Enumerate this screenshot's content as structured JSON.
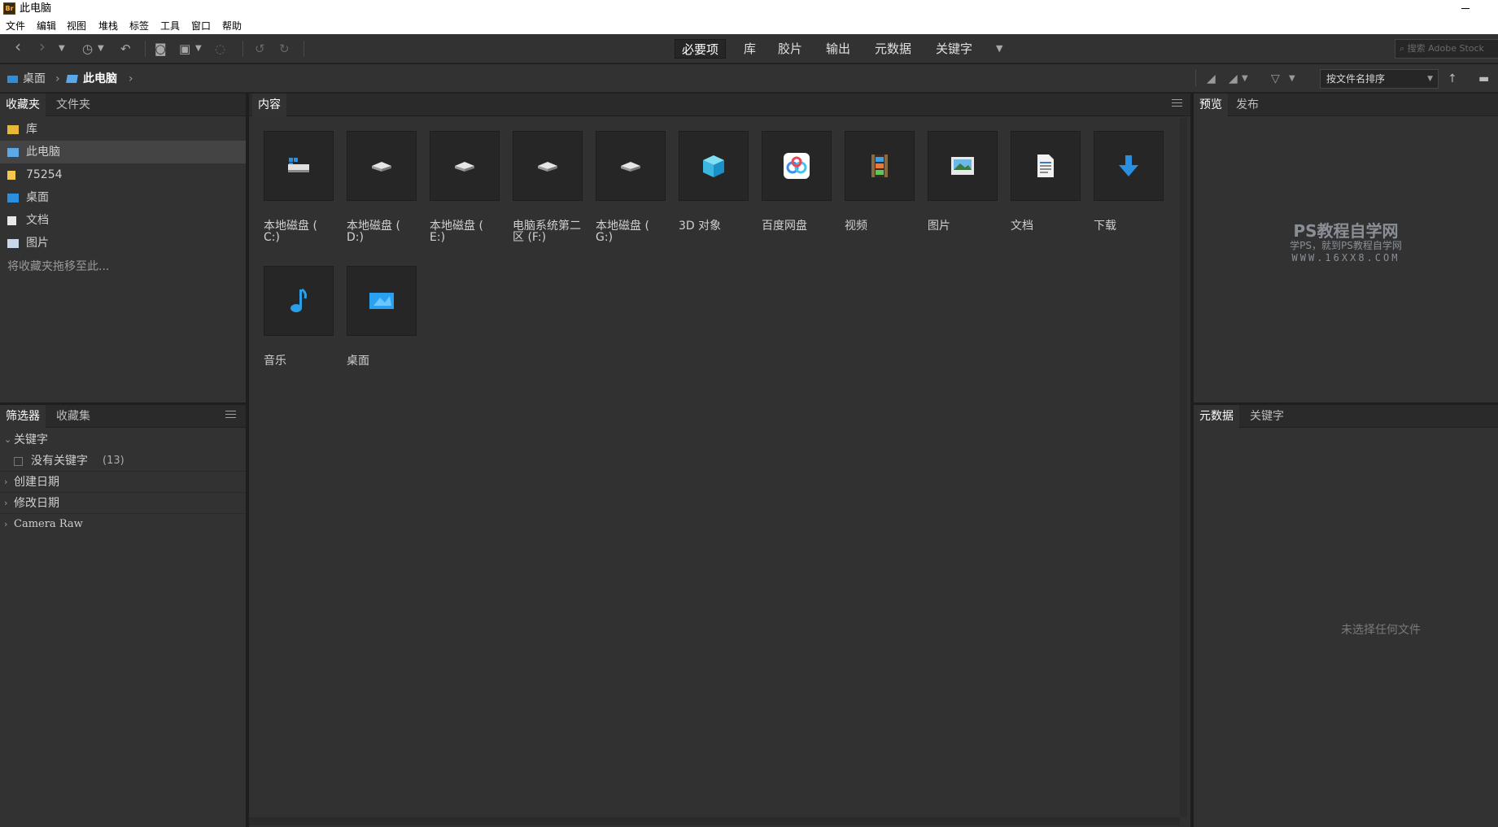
{
  "window": {
    "title": "此电脑",
    "app_badge": "Br"
  },
  "menu": [
    "文件",
    "编辑",
    "视图",
    "堆栈",
    "标签",
    "工具",
    "窗口",
    "帮助"
  ],
  "toolbar": {
    "workspaces": [
      "必要项",
      "库",
      "胶片",
      "输出",
      "元数据",
      "关键字"
    ],
    "active_workspace": "必要项",
    "search_placeholder": "搜索 Adobe Stock"
  },
  "path": {
    "items": [
      "桌面",
      "此电脑"
    ],
    "sort_label": "按文件名排序"
  },
  "favorites": {
    "tabs": [
      "收藏夹",
      "文件夹"
    ],
    "items": [
      "库",
      "此电脑",
      "75254",
      "桌面",
      "文档",
      "图片"
    ],
    "selected": "此电脑",
    "drop_hint": "将收藏夹拖移至此..."
  },
  "filter": {
    "tabs": [
      "筛选器",
      "收藏集"
    ],
    "keyword_header": "关键字",
    "no_keyword": "没有关键字",
    "no_keyword_count": "(13)",
    "rows": [
      "创建日期",
      "修改日期",
      "Camera Raw"
    ]
  },
  "content": {
    "tab": "内容",
    "items": [
      {
        "label": "本地磁盘 ( C:)",
        "icon": "windows-drive-icon"
      },
      {
        "label": "本地磁盘 ( D:)",
        "icon": "drive-icon"
      },
      {
        "label": "本地磁盘 ( E:)",
        "icon": "drive-icon"
      },
      {
        "label": "电脑系统第二区 (F:)",
        "icon": "drive-icon"
      },
      {
        "label": "本地磁盘 ( G:)",
        "icon": "drive-icon"
      },
      {
        "label": "3D 对象",
        "icon": "cube-3d-icon"
      },
      {
        "label": "百度网盘",
        "icon": "baidu-netdisk-icon"
      },
      {
        "label": "视频",
        "icon": "video-folder-icon"
      },
      {
        "label": "图片",
        "icon": "picture-folder-icon"
      },
      {
        "label": "文档",
        "icon": "document-folder-icon"
      },
      {
        "label": "下载",
        "icon": "download-icon"
      },
      {
        "label": "音乐",
        "icon": "music-icon"
      },
      {
        "label": "桌面",
        "icon": "desktop-icon"
      }
    ]
  },
  "preview": {
    "tabs": [
      "预览",
      "发布"
    ],
    "watermark": {
      "line1": "PS教程自学网",
      "line2": "学PS，就到PS教程自学网",
      "line3": "WWW.16XX8.COM"
    }
  },
  "metadata": {
    "tabs": [
      "元数据",
      "关键字"
    ],
    "empty": "未选择任何文件"
  },
  "colors": {
    "accent_blue": "#2a8fe0",
    "panel_bg": "#323232",
    "thumb_bg": "#262626"
  }
}
